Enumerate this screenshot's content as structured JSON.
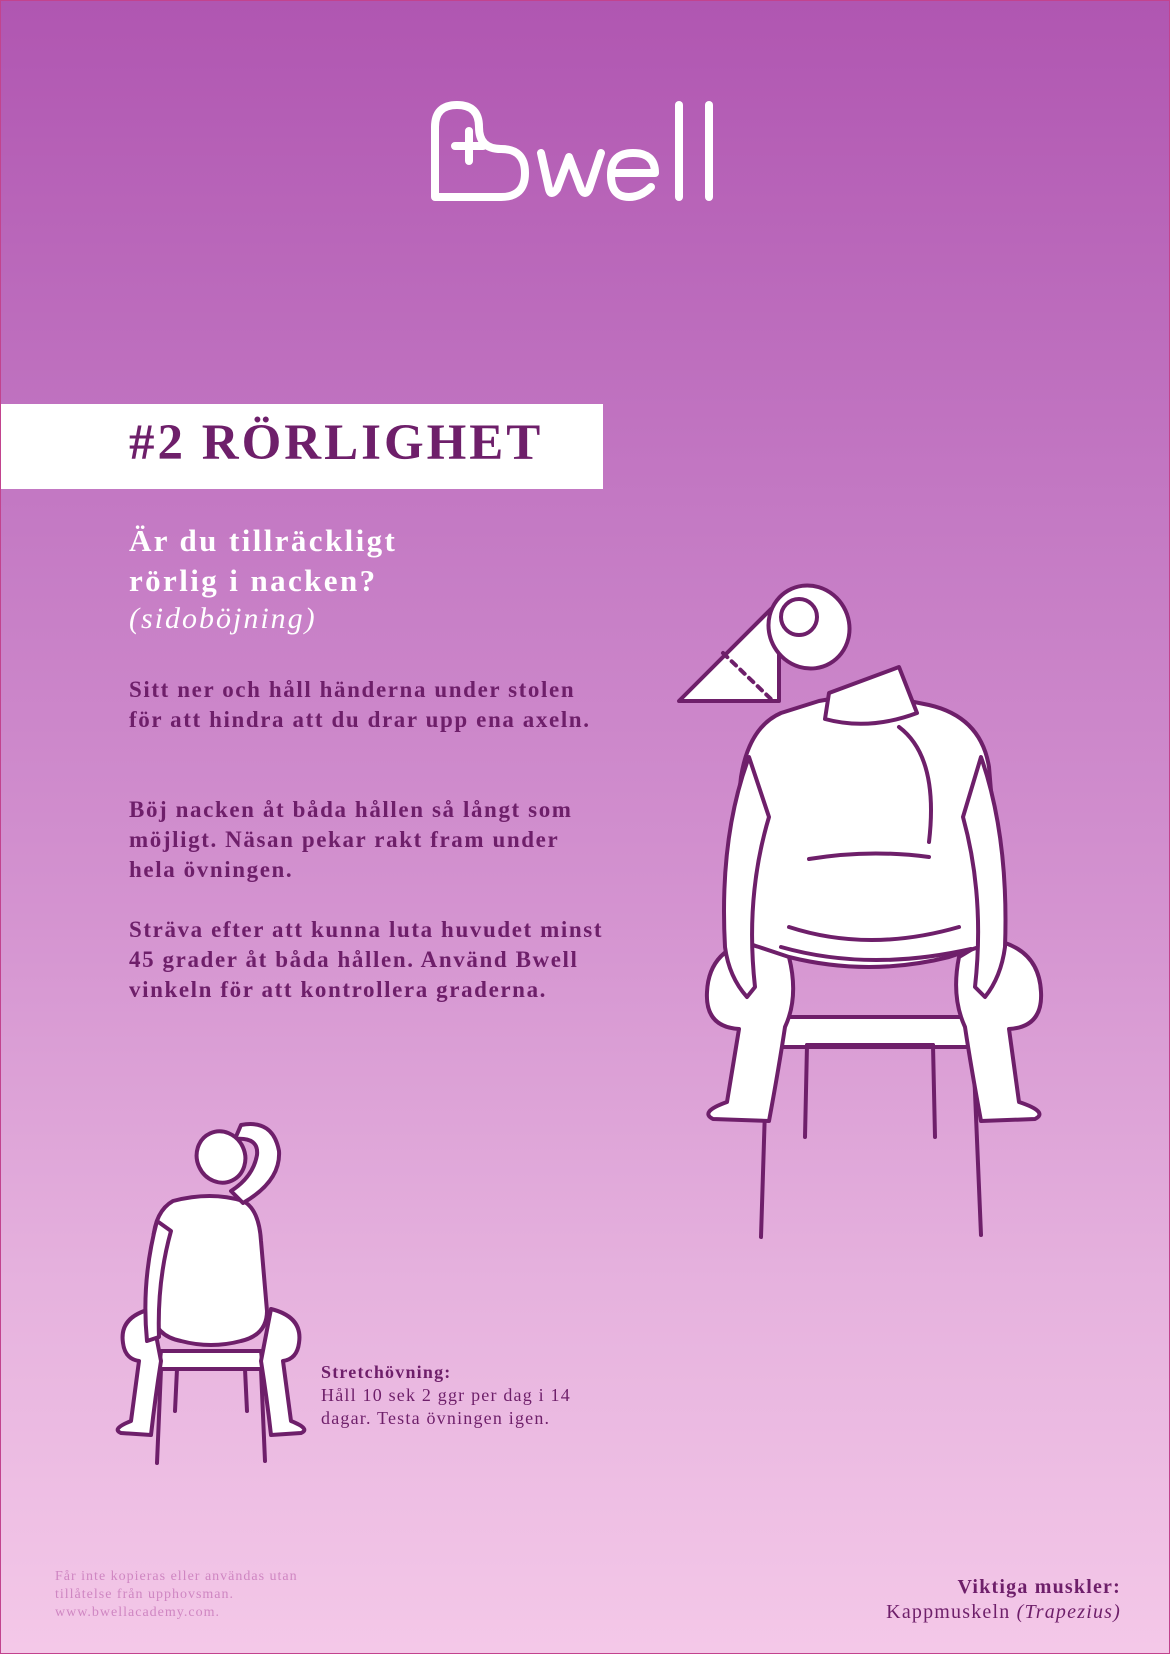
{
  "brand": {
    "name": "Bwell"
  },
  "header": {
    "title": "#2 RÖRLIGHET"
  },
  "intro": {
    "question_line1": "Är du tillräckligt",
    "question_line2": "rörlig i nacken?",
    "subtitle": "(sidoböjning)"
  },
  "instructions": [
    "Sitt ner och håll händerna under stolen för att hindra att du drar upp ena axeln.",
    "Böj nacken åt båda hållen så långt som möjligt. Näsan pekar rakt fram under hela övningen.",
    "Sträva efter att kunna luta huvudet minst 45 grader åt båda hållen. Använd Bwell vinkeln för att kontrollera graderna."
  ],
  "stretch": {
    "heading": "Stretchövning:",
    "text": "Håll 10 sek 2 ggr per dag i 14 dagar. Testa övningen igen."
  },
  "footer": {
    "copyright": "Får inte kopieras eller användas utan tillåtelse från upphovsman. www.bwellacademy.com.",
    "muscles_heading": "Viktiga muskler:",
    "muscle_name": "Kappmuskeln",
    "muscle_latin": "(Trapezius)"
  },
  "colors": {
    "accent": "#6e1f6a",
    "gradient_top": "#b056b1",
    "gradient_bottom": "#f4c8e8",
    "white": "#ffffff"
  },
  "icons": [
    "bwell-logo-icon",
    "angle-triangle-icon",
    "seated-person-back-illustration",
    "seated-stretch-illustration"
  ]
}
